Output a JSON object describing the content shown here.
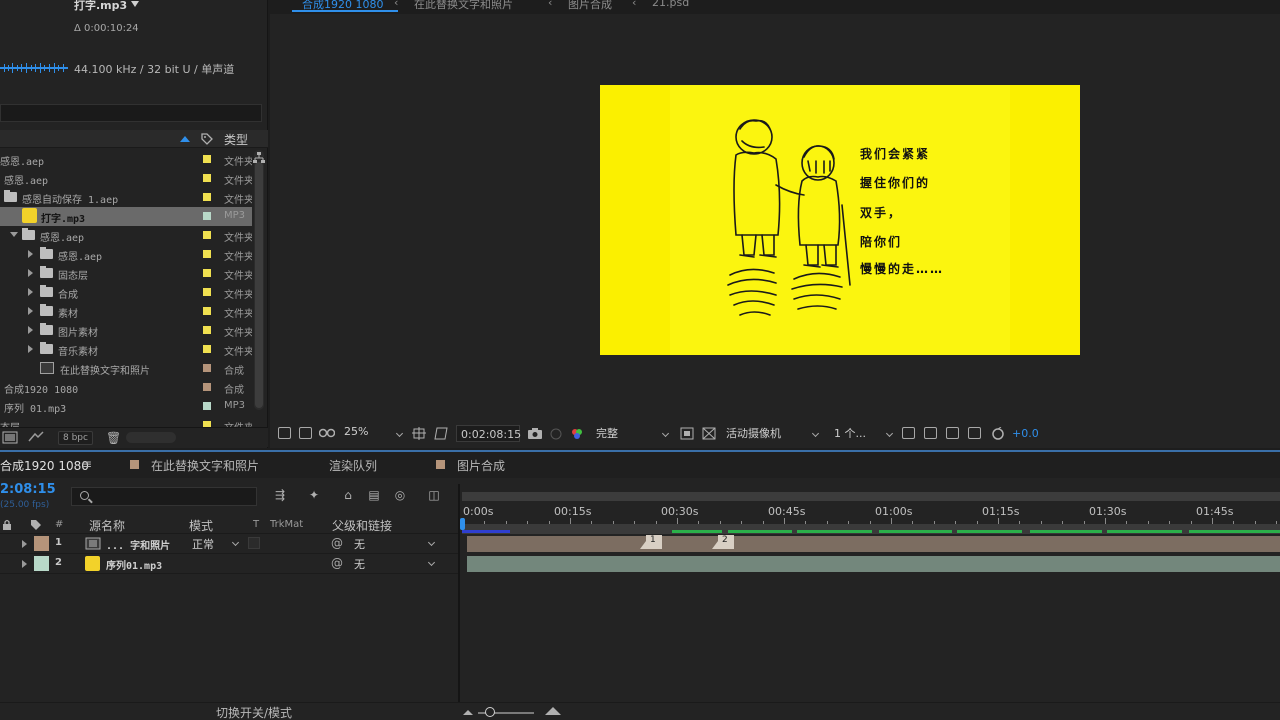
{
  "project": {
    "file_name": "打字.mp3",
    "duration": "Δ 0:00:10:24",
    "audio_info": "44.100 kHz / 32 bit U / 单声道",
    "col_type": "类型",
    "items": [
      {
        "label": "感恩.aep",
        "type": "文件夹",
        "color": "#f0e050"
      },
      {
        "label": "感恩.aep",
        "type": "文件夹",
        "color": "#f0e050"
      },
      {
        "label": "感恩自动保存 1.aep",
        "type": "文件夹",
        "color": "#f0e050"
      },
      {
        "label": "打字.mp3",
        "type": "MP3",
        "color": "#b8d8c8"
      },
      {
        "label": "感恩.aep",
        "type": "文件夹",
        "color": "#f0e050"
      },
      {
        "label": "感恩.aep",
        "type": "文件夹",
        "color": "#f0e050"
      },
      {
        "label": "固态层",
        "type": "文件夹",
        "color": "#f0e050"
      },
      {
        "label": "合成",
        "type": "文件夹",
        "color": "#f0e050"
      },
      {
        "label": "素材",
        "type": "文件夹",
        "color": "#f0e050"
      },
      {
        "label": "图片素材",
        "type": "文件夹",
        "color": "#f0e050"
      },
      {
        "label": "音乐素材",
        "type": "文件夹",
        "color": "#f0e050"
      },
      {
        "label": "在此替换文字和照片",
        "type": "合成",
        "color": "#b5947a"
      },
      {
        "label": "合成1920 1080",
        "type": "合成",
        "color": "#b5947a"
      },
      {
        "label": "序列 01.mp3",
        "type": "MP3",
        "color": "#b8d8c8"
      },
      {
        "label": "态层",
        "type": "文件夹",
        "color": "#f0e050"
      }
    ],
    "bpc": "8 bpc"
  },
  "viewer": {
    "breadcrumbs": [
      "合成1920 1080",
      "在此替换文字和照片",
      "图片合成",
      "21.psd"
    ],
    "poem_lines": [
      "我们会紧紧",
      "握住你们的",
      "双手，",
      "陪你们",
      "慢慢的走……"
    ],
    "zoom": "25%",
    "timecode": "0:02:08:15",
    "resolution": "完整",
    "camera": "活动摄像机",
    "views": "1 个...",
    "exposure": "+0.0"
  },
  "timeline": {
    "tabs": [
      {
        "label": "合成1920 1080"
      },
      {
        "label": "在此替换文字和照片"
      },
      {
        "label": "渲染队列"
      },
      {
        "label": "图片合成"
      }
    ],
    "current_time": "2:08:15",
    "fps": "(25.00 fps)",
    "columns": {
      "num": "#",
      "source_name": "源名称",
      "mode": "模式",
      "t": "T",
      "trkmat": "TrkMat",
      "parent": "父级和链接"
    },
    "layers": [
      {
        "num": "1",
        "name": "... 字和照片",
        "mode": "正常",
        "parent": "无",
        "color": "#b5947a"
      },
      {
        "num": "2",
        "name": "序列01.mp3",
        "mode": "",
        "parent": "无",
        "color": "#b8d8c8"
      }
    ],
    "ruler_ticks": [
      "0:00s",
      "00:15s",
      "00:30s",
      "00:45s",
      "01:00s",
      "01:15s",
      "01:30s",
      "01:45s"
    ],
    "markers": [
      "1",
      "2"
    ],
    "toggle_label": "切换开关/模式"
  }
}
